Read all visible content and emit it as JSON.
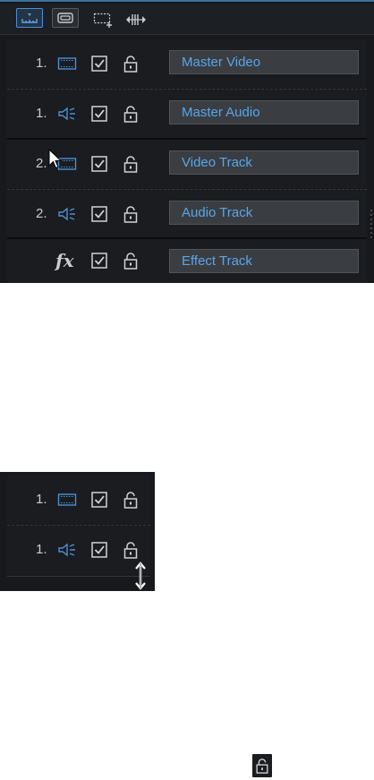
{
  "toolbar": {
    "buttons": [
      {
        "name": "timeline-mode",
        "icon": "timeline-ruler-icon",
        "active": true
      },
      {
        "name": "storyboard-mode",
        "icon": "storyboard-icon",
        "active": false
      }
    ],
    "tools": [
      {
        "name": "add-track",
        "icon": "add-track-icon"
      },
      {
        "name": "fit-tracks",
        "icon": "fit-width-icon"
      }
    ]
  },
  "tracks": [
    {
      "number": "1.",
      "type": "video",
      "icon": "film-icon",
      "checked": true,
      "locked": false,
      "name": "Master Video"
    },
    {
      "number": "1.",
      "type": "audio",
      "icon": "speaker-icon",
      "checked": true,
      "locked": false,
      "name": "Master Audio"
    },
    {
      "number": "2.",
      "type": "video",
      "icon": "film-icon",
      "checked": true,
      "locked": false,
      "name": "Video Track"
    },
    {
      "number": "2.",
      "type": "audio",
      "icon": "speaker-icon",
      "checked": true,
      "locked": false,
      "name": "Audio Track"
    },
    {
      "number": "",
      "type": "effect",
      "fx_label": "fx",
      "icon": "fx-icon",
      "checked": true,
      "locked": false,
      "name": "Effect Track"
    }
  ],
  "mini_panel": {
    "tracks": [
      {
        "number": "1.",
        "type": "video",
        "icon": "film-icon",
        "checked": true,
        "locked": false
      },
      {
        "number": "1.",
        "type": "audio",
        "icon": "speaker-icon",
        "checked": true,
        "locked": false
      }
    ],
    "resize_cursor": "resize-vertical-icon"
  },
  "standalone_icon": "unlock-icon",
  "colors": {
    "accent": "#4c8fd6",
    "text_blue": "#5aa6ea",
    "panel_bg": "#17191c"
  }
}
